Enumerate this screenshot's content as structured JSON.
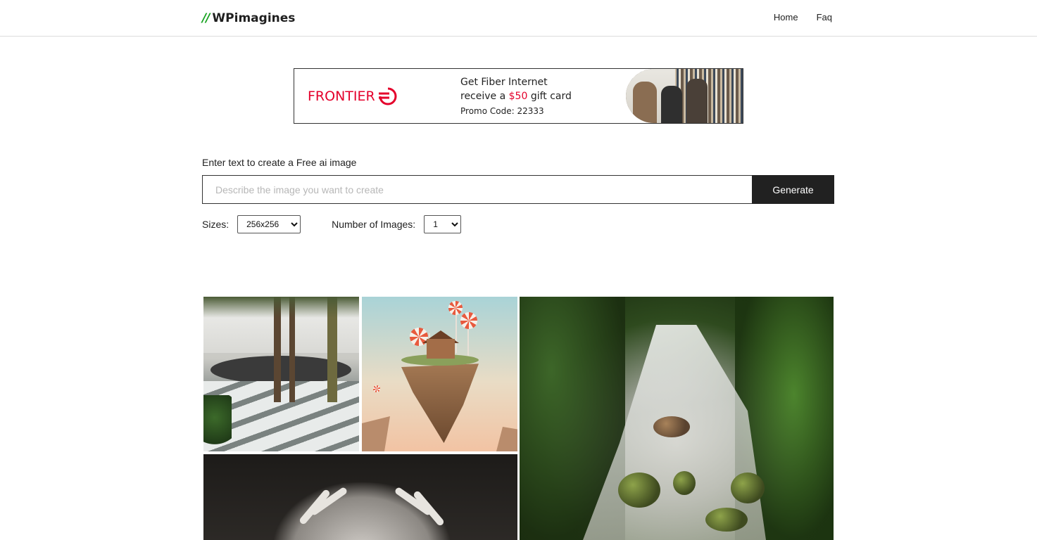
{
  "header": {
    "brand_mark": "//",
    "brand_name": "WPimagines",
    "nav": [
      {
        "label": "Home"
      },
      {
        "label": "Faq"
      }
    ]
  },
  "ad": {
    "logo_text": "FRONTIER",
    "line1": "Get Fiber Internet",
    "line2_prefix": "receive a ",
    "line2_price": "$50",
    "line2_suffix": " gift card",
    "line3": "Promo Code: 22333",
    "brand_color": "#e4002b"
  },
  "form": {
    "label": "Enter text to create a Free ai image",
    "prompt_value": "",
    "prompt_placeholder": "Describe the image you want to create",
    "generate_label": "Generate",
    "sizes_label": "Sizes:",
    "size_selected": "256x256",
    "count_label": "Number of Images:",
    "count_selected": "1"
  },
  "gallery": [
    {
      "subject": "modern courtyard with trees"
    },
    {
      "subject": "floating island with house and lollipops"
    },
    {
      "subject": "forest stream waterfall"
    },
    {
      "subject": "hands holding stone"
    }
  ],
  "colors": {
    "brand_green": "#16a21f",
    "button_bg": "#212121",
    "border": "#dcdcdc"
  }
}
